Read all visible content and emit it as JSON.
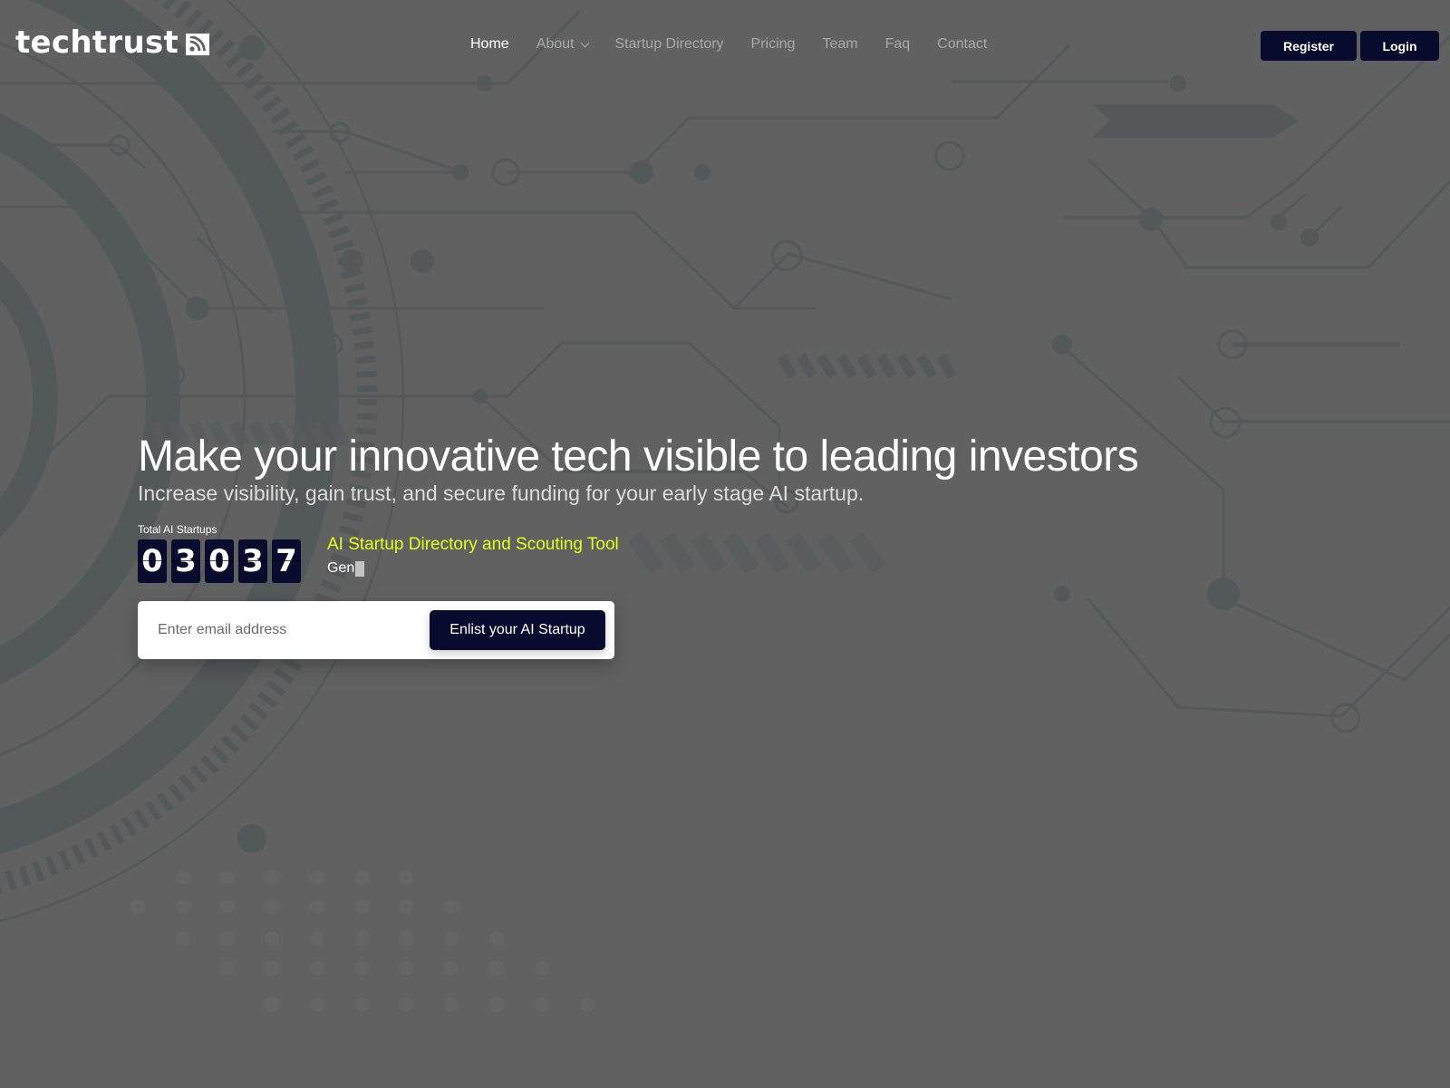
{
  "brand": {
    "name": "techtrust",
    "logo_icon": "rss-feed-icon"
  },
  "nav": {
    "items": [
      {
        "label": "Home",
        "active": true
      },
      {
        "label": "About",
        "has_dropdown": true
      },
      {
        "label": "Startup Directory"
      },
      {
        "label": "Pricing"
      },
      {
        "label": "Team"
      },
      {
        "label": "Faq"
      },
      {
        "label": "Contact"
      }
    ]
  },
  "auth": {
    "register_label": "Register",
    "login_label": "Login"
  },
  "hero": {
    "title": "Make your innovative tech visible to leading investors",
    "subtitle": "Increase visibility, gain trust, and secure funding for your early stage AI startup."
  },
  "stats": {
    "label": "Total AI Startups",
    "digits": [
      "0",
      "3",
      "0",
      "3",
      "7"
    ]
  },
  "tagline": {
    "title": "AI Startup Directory and Scouting Tool",
    "typing_text": "Gen"
  },
  "signup": {
    "email_placeholder": "Enter email address",
    "email_value": "",
    "button_label": "Enlist your AI Startup"
  },
  "colors": {
    "background": "#616161",
    "decoration": "#535858",
    "button": "#080a2e",
    "accent": "#e2ff1a",
    "nav_inactive": "#a9a9a9"
  }
}
